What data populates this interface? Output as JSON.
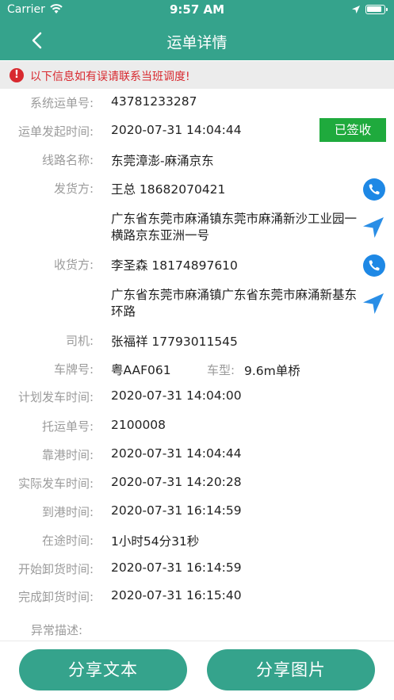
{
  "status_bar": {
    "carrier": "Carrier",
    "time": "9:57 AM"
  },
  "nav": {
    "title": "运单详情"
  },
  "notice": {
    "icon_text": "!",
    "text": "以下信息如有误请联系当班调度!"
  },
  "details": {
    "order_no": {
      "label": "系统运单号:",
      "value": "43781233287"
    },
    "create_time": {
      "label": "运单发起时间:",
      "value": "2020-07-31 14:04:44",
      "badge": "已签收"
    },
    "route": {
      "label": "线路名称:",
      "value": "东莞漳澎-麻涌京东"
    },
    "shipper": {
      "label": "发货方:",
      "name_phone": "王总  18682070421",
      "address": "广东省东莞市麻涌镇东莞市麻涌新沙工业园一横路京东亚洲一号"
    },
    "receiver": {
      "label": "收货方:",
      "name_phone": "李圣森  18174897610",
      "address": "广东省东莞市麻涌镇广东省东莞市麻涌新基东环路"
    },
    "driver": {
      "label": "司机:",
      "value": "张福祥  17793011545"
    },
    "plate": {
      "label": "车牌号:",
      "value": "粤AAF061",
      "type_label": "车型:",
      "type_value": "9.6m单桥"
    },
    "plan_depart": {
      "label": "计划发车时间:",
      "value": "2020-07-31 14:04:00"
    },
    "consign_no": {
      "label": "托运单号:",
      "value": "2100008"
    },
    "dock_time": {
      "label": "靠港时间:",
      "value": "2020-07-31 14:04:44"
    },
    "actual_depart": {
      "label": "实际发车时间:",
      "value": "2020-07-31 14:20:28"
    },
    "arrive_time": {
      "label": "到港时间:",
      "value": "2020-07-31 16:14:59"
    },
    "transit_time": {
      "label": "在途时间:",
      "value": "1小时54分31秒"
    },
    "unload_start": {
      "label": "开始卸货时间:",
      "value": "2020-07-31 16:14:59"
    },
    "unload_end": {
      "label": "完成卸货时间:",
      "value": "2020-07-31 16:15:40"
    },
    "exception": {
      "label": "异常描述:",
      "value": ""
    }
  },
  "footer": {
    "share_text": "分享文本",
    "share_image": "分享图片"
  },
  "colors": {
    "primary": "#35a38c",
    "signed_badge": "#1faa3d",
    "warning": "#d8292f",
    "action_blue": "#1e88e5"
  },
  "icons": {
    "back": "chevron-left-icon",
    "phone": "phone-icon",
    "navigate": "navigation-arrow-icon",
    "warning": "exclamation-icon"
  }
}
